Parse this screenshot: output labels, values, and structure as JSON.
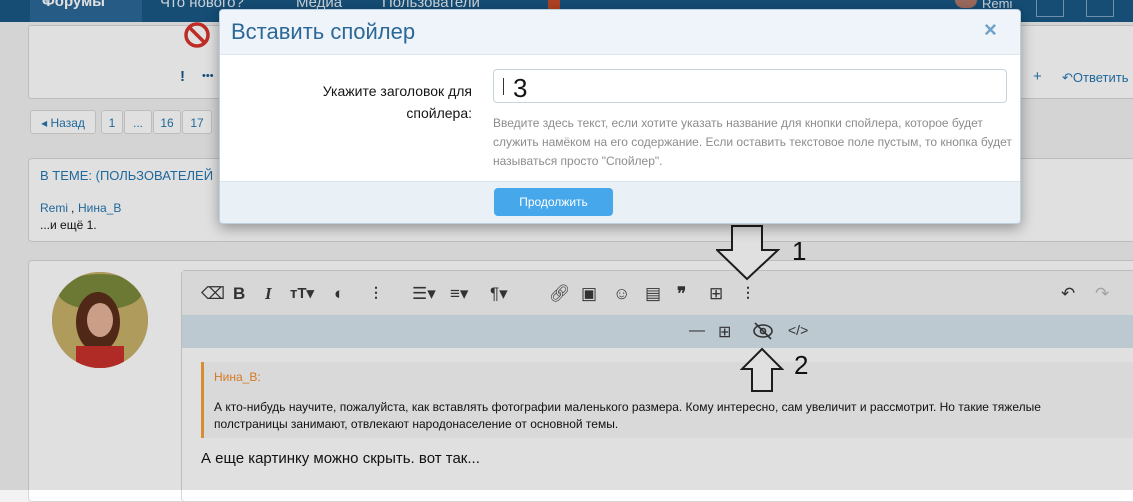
{
  "nav": {
    "active": "Форумы",
    "items": [
      "Что нового?",
      "Медиа",
      "Пользователи"
    ],
    "user": "Remi"
  },
  "thread": {
    "exclaim": "!",
    "more": "•••",
    "reply": "Ответить",
    "plus": "+"
  },
  "pagination": {
    "back": "Назад",
    "pages": [
      "1",
      "...",
      "16",
      "17"
    ]
  },
  "in_thread": {
    "title": "В ТЕМЕ: (ПОЛЬЗОВАТЕЛЕЙ",
    "users": [
      "Remi",
      "Нина_В"
    ],
    "sep": ",",
    "more": "...и ещё 1."
  },
  "editor": {
    "quote_author": "Нина_В:",
    "quote_text_1": "А кто-нибудь научите, пожалуйста, как вставлять фотографии маленького размера. Кому интересно, сам увеличит и рассмотрит.  Но такие тяжелые",
    "quote_text_2": "полстраницы занимают, отвлекают народонаселение от основной темы.",
    "body": "А еще картинку можно скрыть. вот так..."
  },
  "annotations": {
    "arrow1": "1",
    "arrow2": "2"
  },
  "modal": {
    "title": "Вставить спойлер",
    "close": "×",
    "label": "Укажите заголовок для спойлера:",
    "input_value": "3",
    "hint": "Введите здесь текст, если хотите указать название для кнопки спойлера, которое будет служить намёком на его содержание. Если оставить текстовое поле пустым, то кнопка будет называться просто \"Спойлер\".",
    "submit": "Продолжить"
  },
  "colors": {
    "accent": "#2b6898",
    "button": "#47a7eb",
    "quote_border": "#f6a03c"
  }
}
